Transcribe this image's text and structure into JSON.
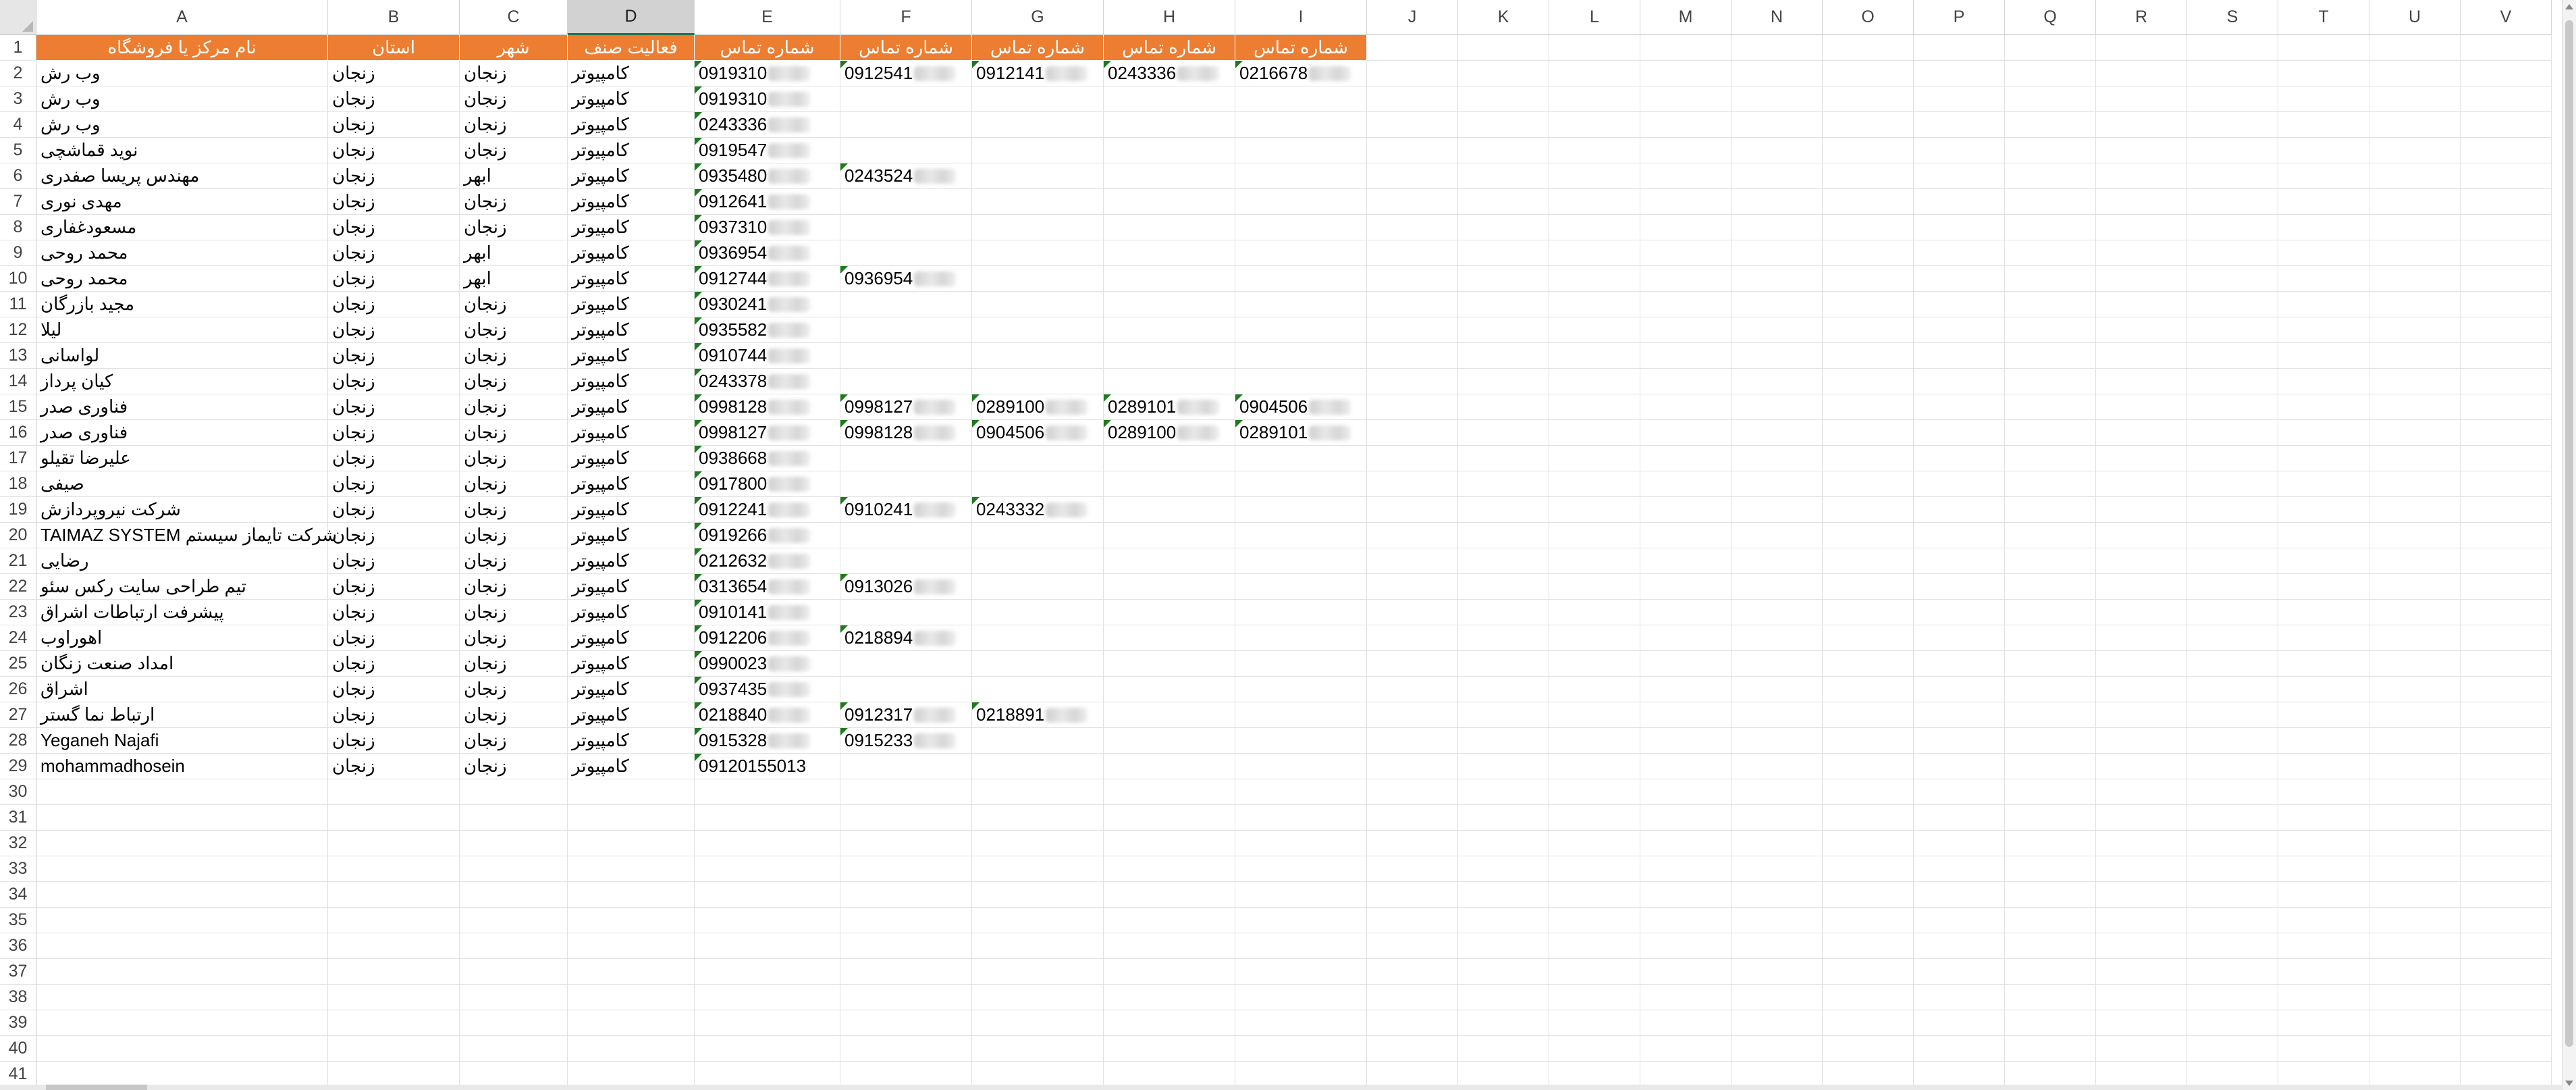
{
  "spreadsheet": {
    "columns": [
      "A",
      "B",
      "C",
      "D",
      "E",
      "F",
      "G",
      "H",
      "I",
      "J",
      "K",
      "L",
      "M",
      "N",
      "O",
      "P",
      "Q",
      "R",
      "S",
      "T",
      "U",
      "V"
    ],
    "selected_column": "D",
    "row_numbers": [
      "1",
      "2",
      "3",
      "4",
      "5",
      "6",
      "7",
      "8",
      "9",
      "10",
      "11",
      "12",
      "13",
      "14",
      "15",
      "16",
      "17",
      "18",
      "19",
      "20",
      "21",
      "22",
      "23",
      "24",
      "25",
      "26",
      "27",
      "28",
      "29",
      "30",
      "31",
      "32",
      "33",
      "34",
      "35",
      "36",
      "37",
      "38",
      "39",
      "40",
      "41"
    ],
    "header_color": "#ed7d31",
    "header_text_color": "#ffffff",
    "headers": [
      "نام مرکز یا فروشگاه",
      "استان",
      "شهر",
      "فعالیت صنف",
      "شماره تماس",
      "شماره تماس",
      "شماره تماس",
      "شماره تماس",
      "شماره تماس"
    ],
    "rows": [
      {
        "name": "وب رش",
        "province": "زنجان",
        "city": "زنجان",
        "activity": "کامپیوتر",
        "phones": [
          "0919310",
          "0912541",
          "0912141",
          "0243336",
          "0216678"
        ]
      },
      {
        "name": "وب رش",
        "province": "زنجان",
        "city": "زنجان",
        "activity": "کامپیوتر",
        "phones": [
          "0919310"
        ]
      },
      {
        "name": "وب رش",
        "province": "زنجان",
        "city": "زنجان",
        "activity": "کامپیوتر",
        "phones": [
          "0243336"
        ]
      },
      {
        "name": "نوید قماشچی",
        "province": "زنجان",
        "city": "زنجان",
        "activity": "کامپیوتر",
        "phones": [
          "0919547"
        ]
      },
      {
        "name": "مهندس پریسا صفدری",
        "province": "زنجان",
        "city": "ابهر",
        "activity": "کامپیوتر",
        "phones": [
          "0935480",
          "0243524"
        ]
      },
      {
        "name": "مهدی نوری",
        "province": "زنجان",
        "city": "زنجان",
        "activity": "کامپیوتر",
        "phones": [
          "0912641"
        ]
      },
      {
        "name": "مسعودغفاری",
        "province": "زنجان",
        "city": "زنجان",
        "activity": "کامپیوتر",
        "phones": [
          "0937310"
        ]
      },
      {
        "name": "محمد روحی",
        "province": "زنجان",
        "city": "ابهر",
        "activity": "کامپیوتر",
        "phones": [
          "0936954"
        ]
      },
      {
        "name": "محمد روحی",
        "province": "زنجان",
        "city": "ابهر",
        "activity": "کامپیوتر",
        "phones": [
          "0912744",
          "0936954"
        ]
      },
      {
        "name": "مجید بازرگان",
        "province": "زنجان",
        "city": "زنجان",
        "activity": "کامپیوتر",
        "phones": [
          "0930241"
        ]
      },
      {
        "name": "لیلا",
        "province": "زنجان",
        "city": "زنجان",
        "activity": "کامپیوتر",
        "phones": [
          "0935582"
        ]
      },
      {
        "name": "لواسانی",
        "province": "زنجان",
        "city": "زنجان",
        "activity": "کامپیوتر",
        "phones": [
          "0910744"
        ]
      },
      {
        "name": "کیان پرداز",
        "province": "زنجان",
        "city": "زنجان",
        "activity": "کامپیوتر",
        "phones": [
          "0243378"
        ]
      },
      {
        "name": "فناوری صدر",
        "province": "زنجان",
        "city": "زنجان",
        "activity": "کامپیوتر",
        "phones": [
          "0998128",
          "0998127",
          "0289100",
          "0289101",
          "0904506"
        ]
      },
      {
        "name": "فناوری صدر",
        "province": "زنجان",
        "city": "زنجان",
        "activity": "کامپیوتر",
        "phones": [
          "0998127",
          "0998128",
          "0904506",
          "0289100",
          "0289101"
        ]
      },
      {
        "name": "علیرضا تقیلو",
        "province": "زنجان",
        "city": "زنجان",
        "activity": "کامپیوتر",
        "phones": [
          "0938668"
        ]
      },
      {
        "name": "صیفی",
        "province": "زنجان",
        "city": "زنجان",
        "activity": "کامپیوتر",
        "phones": [
          "0917800"
        ]
      },
      {
        "name": "شرکت نیروپردازش",
        "province": "زنجان",
        "city": "زنجان",
        "activity": "کامپیوتر",
        "phones": [
          "0912241",
          "0910241",
          "0243332"
        ]
      },
      {
        "name": "شرکت تایماز سیستم TAIMAZ SYSTEM",
        "province": "زنجان",
        "city": "زنجان",
        "activity": "کامپیوتر",
        "phones": [
          "0919266"
        ]
      },
      {
        "name": "رضایی",
        "province": "زنجان",
        "city": "زنجان",
        "activity": "کامپیوتر",
        "phones": [
          "0212632"
        ]
      },
      {
        "name": "تیم طراحی سایت رکس سئو",
        "province": "زنجان",
        "city": "زنجان",
        "activity": "کامپیوتر",
        "phones": [
          "0313654",
          "0913026"
        ]
      },
      {
        "name": "پیشرفت ارتباطات اشراق",
        "province": "زنجان",
        "city": "زنجان",
        "activity": "کامپیوتر",
        "phones": [
          "0910141"
        ]
      },
      {
        "name": "اهوراوب",
        "province": "زنجان",
        "city": "زنجان",
        "activity": "کامپیوتر",
        "phones": [
          "0912206",
          "0218894"
        ]
      },
      {
        "name": "امداد صنعت زنگان",
        "province": "زنجان",
        "city": "زنجان",
        "activity": "کامپیوتر",
        "phones": [
          "0990023"
        ]
      },
      {
        "name": "اشراق",
        "province": "زنجان",
        "city": "زنجان",
        "activity": "کامپیوتر",
        "phones": [
          "0937435"
        ]
      },
      {
        "name": "ارتباط نما گستر",
        "province": "زنجان",
        "city": "زنجان",
        "activity": "کامپیوتر",
        "phones": [
          "0218840",
          "0912317",
          "0218891"
        ]
      },
      {
        "name": "Yeganeh Najafi",
        "province": "زنجان",
        "city": "زنجان",
        "activity": "کامپیوتر",
        "phones": [
          "0915328",
          "0915233"
        ]
      },
      {
        "name": "mohammadhosein",
        "province": "زنجان",
        "city": "زنجان",
        "activity": "کامپیوتر",
        "phones": [
          "09120155013"
        ]
      }
    ]
  }
}
